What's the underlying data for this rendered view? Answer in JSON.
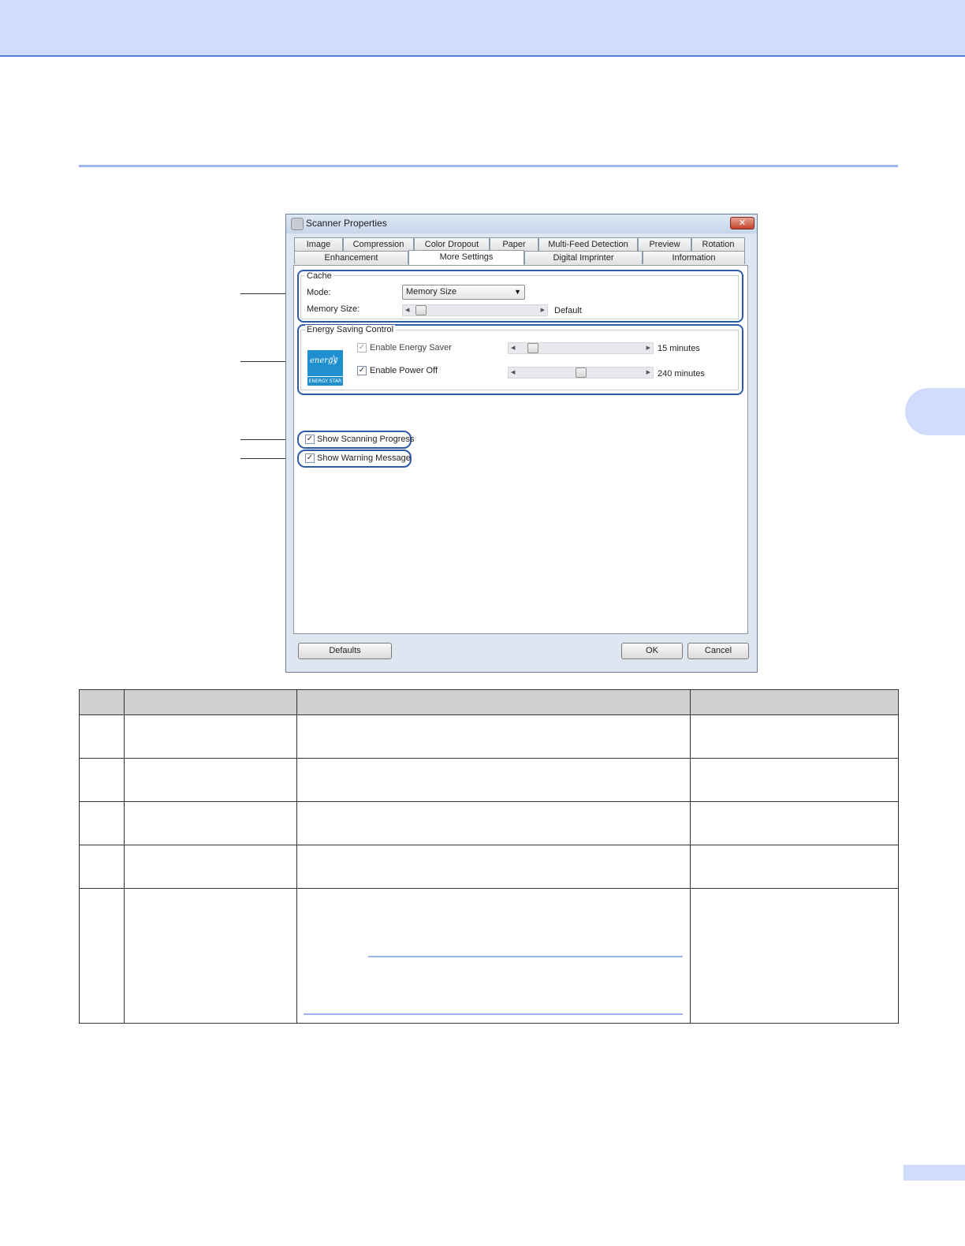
{
  "dialog": {
    "title": "Scanner Properties",
    "close_glyph": "✕",
    "tabs_row1": [
      "Image",
      "Compression",
      "Color Dropout",
      "Paper",
      "Multi-Feed Detection",
      "Preview",
      "Rotation"
    ],
    "tabs_row2": [
      "Enhancement",
      "More Settings",
      "Digital Imprinter",
      "Information"
    ],
    "active_tab": "More Settings",
    "cache": {
      "group_title": "Cache",
      "mode_label": "Mode:",
      "mode_value": "Memory Size",
      "memory_size_label": "Memory Size:",
      "memory_size_value": "Default",
      "memory_size_level": 0.0
    },
    "energy": {
      "group_title": "Energy Saving Control",
      "logo_text": "energy",
      "logo_band": "ENERGY STAR",
      "energy_saver_label": "Enable Energy Saver",
      "energy_saver_checked": true,
      "energy_saver_value": "15 minutes",
      "energy_saver_level": 0.14,
      "power_off_label": "Enable Power Off",
      "power_off_checked": true,
      "power_off_value": "240 minutes",
      "power_off_level": 0.5
    },
    "show_scanning_progress": {
      "label": "Show Scanning Progress",
      "checked": true
    },
    "show_warning_message": {
      "label": "Show Warning Message",
      "checked": true
    },
    "buttons": {
      "defaults": "Defaults",
      "ok": "OK",
      "cancel": "Cancel"
    }
  },
  "check_glyph": "✓",
  "colors": {
    "banner": "#cfdcfb",
    "accent_rule": "#9fb4f3",
    "highlight_outline": "#2e5ba7",
    "energy_star_blue": "#1f8fcf"
  }
}
